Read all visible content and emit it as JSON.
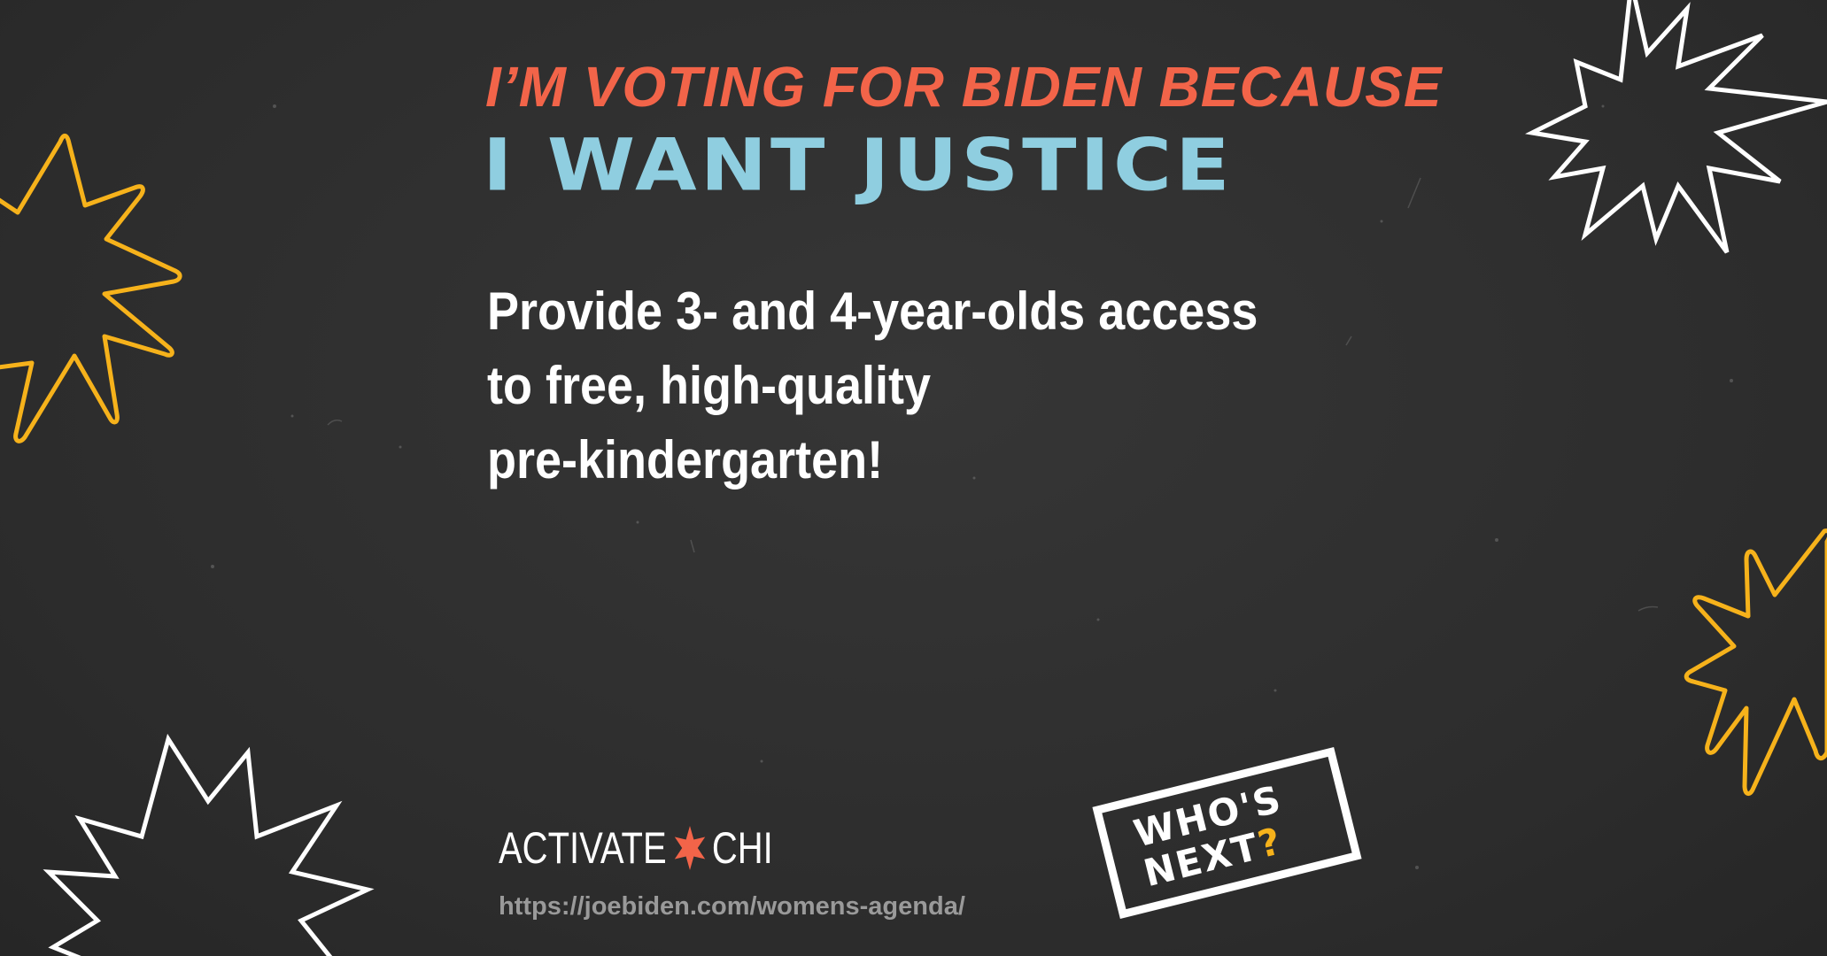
{
  "headline": {
    "line1": "I’M VOTING FOR BIDEN BECAUSE",
    "line2": "I WANT JUSTICE"
  },
  "body": {
    "line1": "Provide 3- and 4-year-olds access",
    "line2": "to free, high-quality",
    "line3": "pre-kindergarten!"
  },
  "brand": {
    "left": "ACTIVATE",
    "right": "CHI",
    "star_icon": "six-point-star-icon"
  },
  "url": "https://joebiden.com/womens-agenda/",
  "badge": {
    "line1": "WHO'S",
    "line2_text": "NEXT",
    "line2_mark": "?"
  },
  "colors": {
    "background": "#2f2f2f",
    "coral": "#f26449",
    "light_blue": "#8fcee0",
    "yellow": "#f6b21b",
    "white": "#ffffff",
    "gray_text": "#9a9a9a"
  },
  "decorations": [
    "starburst-outline-white-icon",
    "starburst-outline-yellow-icon"
  ]
}
